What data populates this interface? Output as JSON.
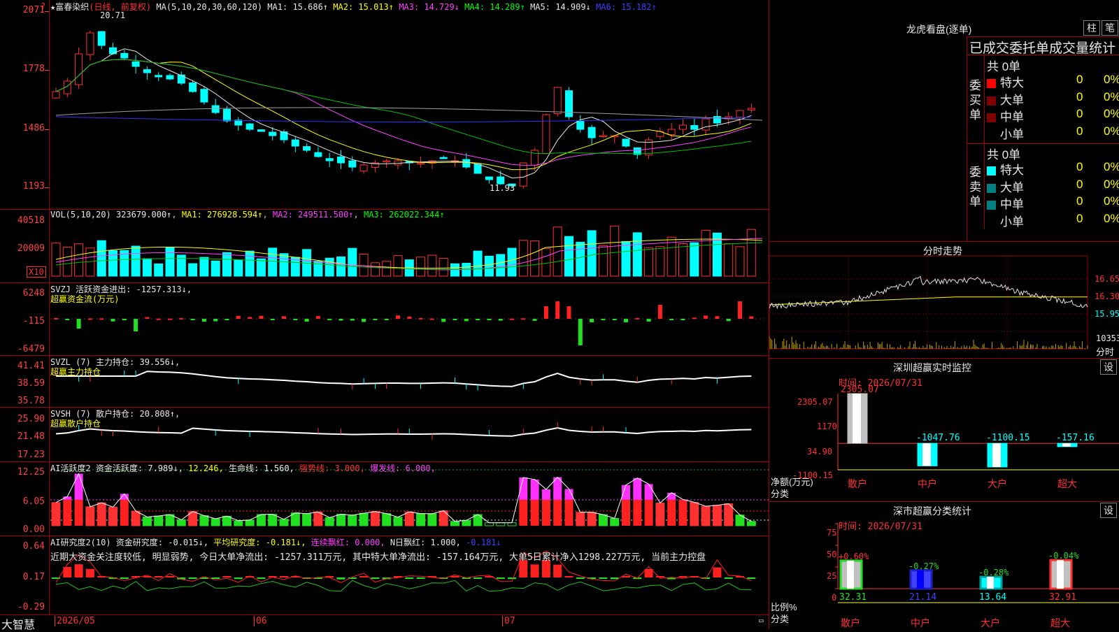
{
  "stock": {
    "title": "★富春染织",
    "period": "(日线, 前复权)"
  },
  "main_chart": {
    "ma_header": "MA(5,10,20,30,60,120)",
    "ma": [
      {
        "label": "MA1: 15.686↑",
        "color": "#e8e8e8"
      },
      {
        "label": "MA2: 15.013↑",
        "color": "#ffff00"
      },
      {
        "label": "MA3: 14.729↓",
        "color": "#ff40ff"
      },
      {
        "label": "MA4: 14.289↑",
        "color": "#00ff00"
      },
      {
        "label": "MA5: 14.909↓",
        "color": "#e8e8e8"
      },
      {
        "label": "MA6: 15.182↑",
        "color": "#4040ff"
      }
    ],
    "y_labels": [
      "2071",
      "1778",
      "1486",
      "1193"
    ],
    "high_note": "20.71",
    "low_note": "11.93"
  },
  "vol": {
    "header": "VOL(5,10,20)",
    "value": "323679.000↑",
    "ma1": "MA1: 276928.594↑",
    "ma2": "MA2: 249511.500↑",
    "ma3": "MA3: 262022.344↑",
    "y_labels": [
      "40518",
      "20009"
    ],
    "unit": "X10"
  },
  "svzj": {
    "header": "SVZJ  活跃资金进出: -1257.313↓,",
    "sub": "超赢资金流(万元)",
    "y_labels": [
      "6248",
      "-115",
      "-6479"
    ]
  },
  "svzl": {
    "header": "SVZL (7) 主力持仓: 39.556↓,",
    "sub": "超赢主力持仓",
    "y_labels": [
      "41.41",
      "38.59",
      "35.78"
    ]
  },
  "svsh": {
    "header": "SVSH (7) 散户持仓: 20.808↑,",
    "sub": "超赢散户持仓",
    "y_labels": [
      "25.90",
      "21.48",
      "17.23"
    ]
  },
  "ai1": {
    "header1": "AI活跃度2 资金活跃度: 7.989↓,",
    "v2": "12.246,",
    "v3": "生命线: 1.560,",
    "v4": "强势线: 3.000,",
    "v5": "爆发线: 6.000,",
    "y_labels": [
      "12.25",
      "6.05",
      "0.00"
    ]
  },
  "ai2": {
    "header1": "AI研究度2(10) 资金研究度: -0.015↓,",
    "v2": "平均研究度: -0.181↓,",
    "v3": "连续飘红: 0.000,",
    "v4": "N日飘红: 1.000,",
    "v5": "-0.181↓",
    "comment": "近期大资金关注度较低, 明显弱势, 今日大单净流出: -1257.311万元, 其中特大单净流出: -157.164万元, 大单5日累计净入1298.227万元, 当前主力控盘",
    "y_labels": [
      "0.64",
      "0.17",
      "-0.29"
    ]
  },
  "date_axis": {
    "brand": "大智慧",
    "labels": [
      "2026/05",
      "06",
      "07"
    ]
  },
  "dragon": {
    "title": "龙虎看盘(逐单)",
    "btn1": "柱",
    "btn2": "笔",
    "tabs": "已成交委托单成交量统计",
    "buy_label": "委买单",
    "sell_label": "委卖单",
    "buy_total": "共 0单",
    "sell_total": "共 0单",
    "rows": [
      {
        "name": "特大",
        "val": "0",
        "pct": "0%"
      },
      {
        "name": "大单",
        "val": "0",
        "pct": "0%"
      },
      {
        "name": "中单",
        "val": "0",
        "pct": "0%"
      },
      {
        "name": "小单",
        "val": "0",
        "pct": "0%"
      }
    ]
  },
  "intraday": {
    "title": "分时走势",
    "y_labels": [
      "16.65",
      "16.30",
      "15.95"
    ],
    "vol_label": "10353",
    "unit": "分时"
  },
  "monitor": {
    "title": "深圳超赢实时监控",
    "set": "设",
    "time": "时间: 2026/07/31",
    "y_labels": [
      "2305.07",
      "1170",
      "34.90",
      "-1100.15"
    ],
    "axis_label1": "净额(万元)",
    "axis_label2": "分类",
    "bars": [
      {
        "cat": "散户",
        "value": 2305.07,
        "label": "2305.07"
      },
      {
        "cat": "中户",
        "value": -1047.76,
        "label": "-1047.76"
      },
      {
        "cat": "大户",
        "value": -1100.15,
        "label": "-1100.15"
      },
      {
        "cat": "超大",
        "value": -157.16,
        "label": "-157.16"
      }
    ]
  },
  "classify": {
    "title": "深市超赢分类统计",
    "set": "设",
    "time": "时间: 2026/07/31",
    "y_labels": [
      "75",
      "50",
      "25",
      "0"
    ],
    "axis_label1": "比例%",
    "axis_label2": "分类",
    "bars": [
      {
        "cat": "散户",
        "value": 32.31,
        "change": "+0.60%",
        "label": "32.31"
      },
      {
        "cat": "中户",
        "value": 21.14,
        "change": "-0.27%",
        "label": "21.14"
      },
      {
        "cat": "大户",
        "value": 13.64,
        "change": "-0.28%",
        "label": "13.64"
      },
      {
        "cat": "超大",
        "value": 32.91,
        "change": "-0.04%",
        "label": "32.91"
      }
    ]
  }
}
